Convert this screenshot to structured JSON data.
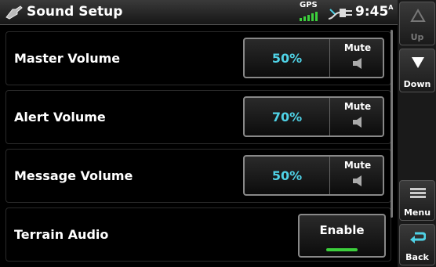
{
  "header": {
    "title": "Sound Setup",
    "gps_label": "GPS",
    "time": "9:45",
    "time_suffix": "A"
  },
  "rows": [
    {
      "label": "Master Volume",
      "value": "50%",
      "mute_label": "Mute"
    },
    {
      "label": "Alert Volume",
      "value": "70%",
      "mute_label": "Mute"
    },
    {
      "label": "Message Volume",
      "value": "50%",
      "mute_label": "Mute"
    }
  ],
  "terrain": {
    "label": "Terrain Audio",
    "button_label": "Enable",
    "enabled": true
  },
  "sidebar": {
    "up": "Up",
    "down": "Down",
    "menu": "Menu",
    "back": "Back"
  },
  "colors": {
    "value_text": "#4fd2e6",
    "enabled_indicator": "#3ccf3c"
  },
  "icons": {
    "app": "sound-setup-icon",
    "gps": "gps-signal-icon",
    "power": "external-power-icon",
    "mute": "speaker-icon",
    "up": "arrow-up-icon",
    "down": "arrow-down-icon",
    "menu": "menu-icon",
    "back": "back-arrow-icon"
  }
}
